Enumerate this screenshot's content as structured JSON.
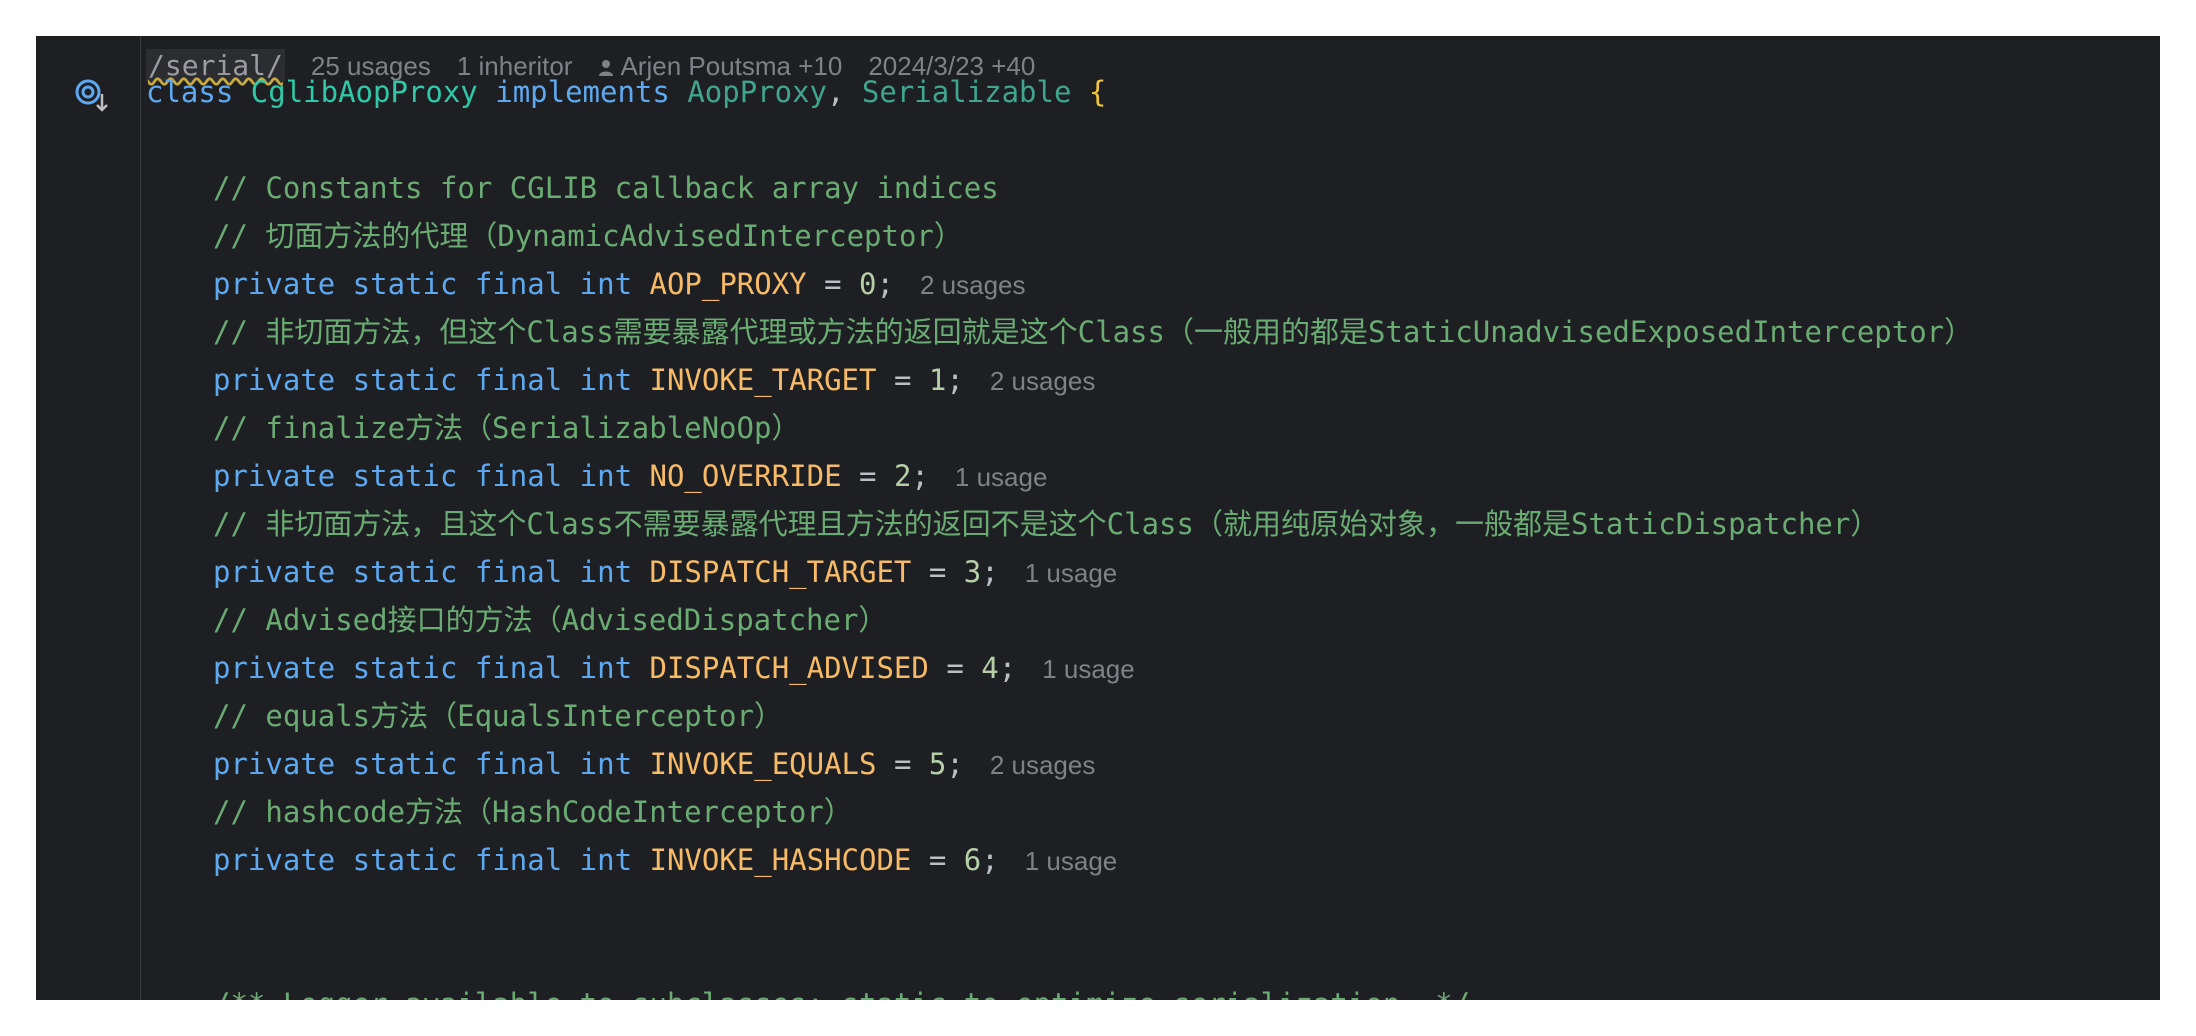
{
  "header": {
    "serial_tag": "/serial/",
    "usages": "25 usages",
    "inheritors": "1 inheritor",
    "authors": "Arjen Poutsma +10",
    "date": "2024/3/23 +40"
  },
  "class_decl": {
    "kw_class": "class",
    "name": "CglibAopProxy",
    "kw_implements": "implements",
    "iface1": "AopProxy",
    "sep": ", ",
    "iface2": "Serializable",
    "brace": " {"
  },
  "lines": [
    {
      "comment": "// Constants for CGLIB callback array indices"
    },
    {
      "comment": "// 切面方法的代理（DynamicAdvisedInterceptor）"
    },
    {
      "mods": "private static final int",
      "name": "AOP_PROXY",
      "eq": " = ",
      "value": "0",
      "semi": ";",
      "hint": "2 usages"
    },
    {
      "comment": "// 非切面方法，但这个Class需要暴露代理或方法的返回就是这个Class（一般用的都是StaticUnadvisedExposedInterceptor）"
    },
    {
      "mods": "private static final int",
      "name": "INVOKE_TARGET",
      "eq": " = ",
      "value": "1",
      "semi": ";",
      "hint": "2 usages"
    },
    {
      "comment": "// finalize方法（SerializableNoOp）"
    },
    {
      "mods": "private static final int",
      "name": "NO_OVERRIDE",
      "eq": " = ",
      "value": "2",
      "semi": ";",
      "hint": "1 usage"
    },
    {
      "comment": "// 非切面方法，且这个Class不需要暴露代理且方法的返回不是这个Class（就用纯原始对象，一般都是StaticDispatcher）"
    },
    {
      "mods": "private static final int",
      "name": "DISPATCH_TARGET",
      "eq": " = ",
      "value": "3",
      "semi": ";",
      "hint": "1 usage"
    },
    {
      "comment": "// Advised接口的方法（AdvisedDispatcher）"
    },
    {
      "mods": "private static final int",
      "name": "DISPATCH_ADVISED",
      "eq": " = ",
      "value": "4",
      "semi": ";",
      "hint": "1 usage"
    },
    {
      "comment": "// equals方法（EqualsInterceptor）"
    },
    {
      "mods": "private static final int",
      "name": "INVOKE_EQUALS",
      "eq": " = ",
      "value": "5",
      "semi": ";",
      "hint": "2 usages"
    },
    {
      "comment": "// hashcode方法（HashCodeInterceptor）"
    },
    {
      "mods": "private static final int",
      "name": "INVOKE_HASHCODE",
      "eq": " = ",
      "value": "6",
      "semi": ";",
      "hint": "1 usage"
    }
  ],
  "cut_off_line": "/** Logger available to subclasses; static to optimize serialization. */",
  "icons": {
    "gutter": "implementation-down-icon",
    "author": "person-icon"
  }
}
